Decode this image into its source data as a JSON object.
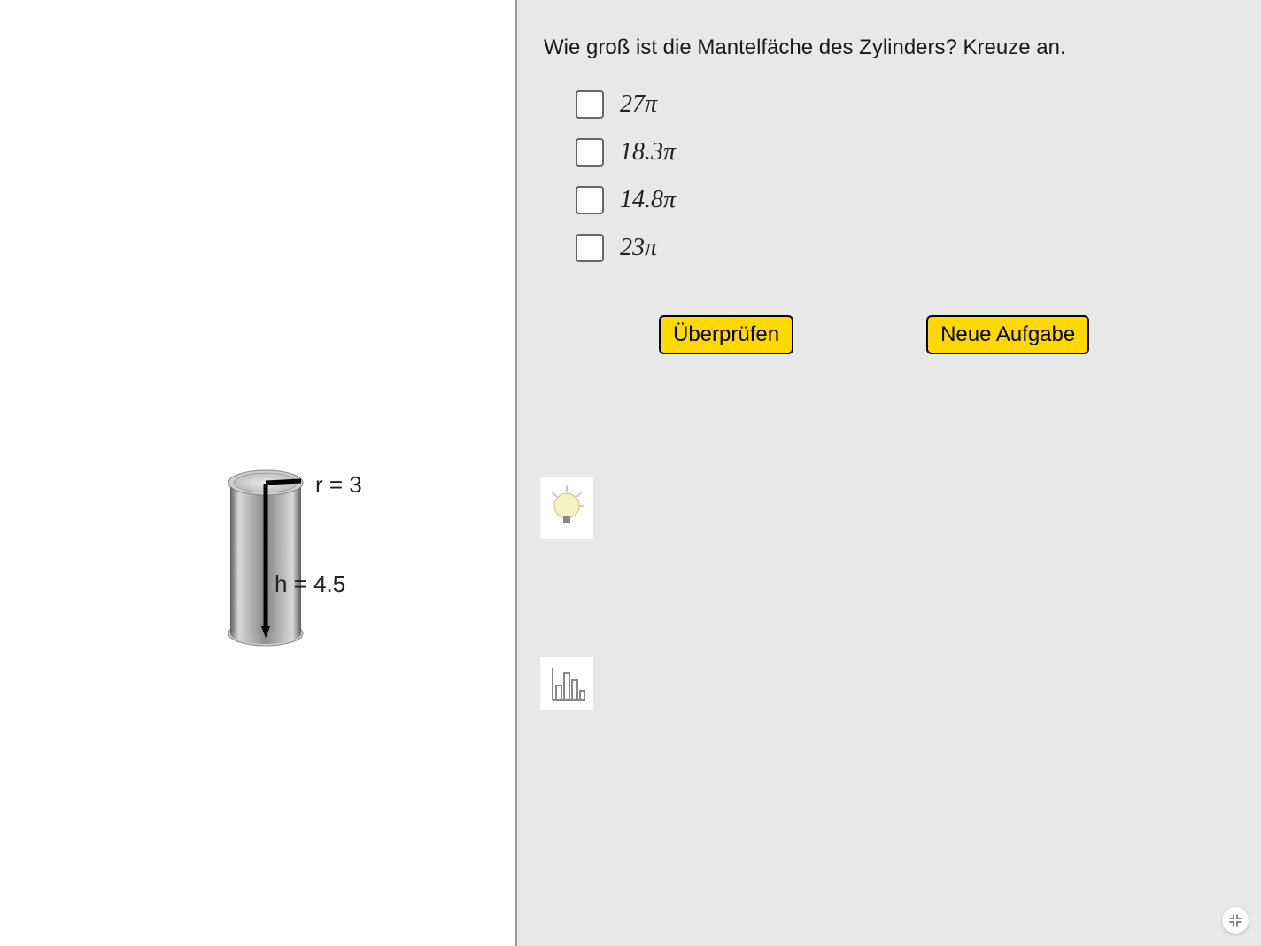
{
  "question": "Wie groß ist die Mantelfäche des Zylinders? Kreuze an.",
  "options": [
    {
      "value": "27",
      "suffix": "π"
    },
    {
      "value": "18.3",
      "suffix": "π"
    },
    {
      "value": "14.8",
      "suffix": "π"
    },
    {
      "value": "23",
      "suffix": "π"
    }
  ],
  "buttons": {
    "check": "Überprüfen",
    "new": "Neue Aufgabe"
  },
  "cylinder": {
    "r_label": "r = 3",
    "h_label": "h = 4.5"
  }
}
